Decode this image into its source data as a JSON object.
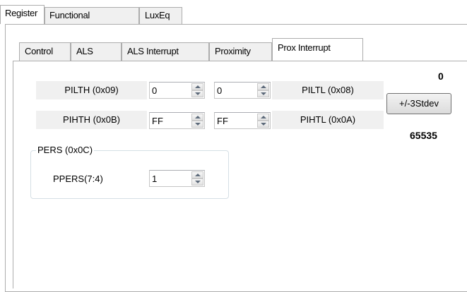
{
  "outer_tabs": [
    {
      "label": "Register",
      "active": true
    },
    {
      "label": "Functional",
      "active": false
    },
    {
      "label": "LuxEq",
      "active": false
    }
  ],
  "inner_tabs": [
    {
      "label": "Control",
      "active": false
    },
    {
      "label": "ALS",
      "active": false
    },
    {
      "label": "ALS Interrupt",
      "active": false
    },
    {
      "label": "Proximity",
      "active": false
    },
    {
      "label": "Prox Interrupt",
      "active": true
    }
  ],
  "rows": [
    {
      "left_label": "PILTH (0x09)",
      "left_value": "0",
      "right_value": "0",
      "right_label": "PILTL (0x08)"
    },
    {
      "left_label": "PIHTH (0x0B)",
      "left_value": "FF",
      "right_value": "FF",
      "right_label": "PIHTL (0x0A)"
    }
  ],
  "low_value": "0",
  "stdev_button": "+/-3Stdev",
  "high_value": "65535",
  "pers_group": {
    "title": "PERS (0x0C)",
    "label": "PPERS(7:4)",
    "value": "1"
  }
}
